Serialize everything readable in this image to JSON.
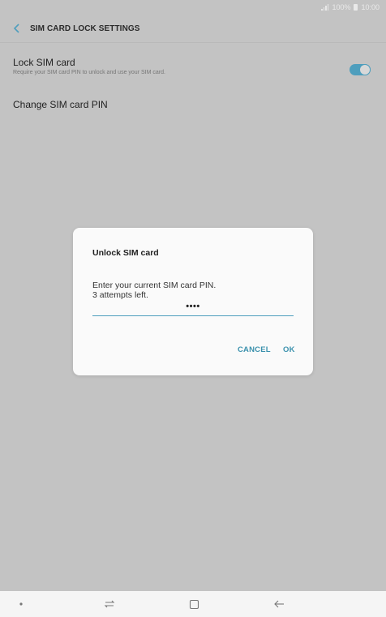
{
  "status_bar": {
    "battery": "100%",
    "time": "10:00"
  },
  "header": {
    "title": "SIM CARD LOCK SETTINGS"
  },
  "settings": {
    "lock_sim": {
      "title": "Lock SIM card",
      "subtitle": "Require your SIM card PIN to unlock and use your SIM card.",
      "enabled": true
    },
    "change_pin": {
      "title": "Change SIM card PIN"
    }
  },
  "dialog": {
    "title": "Unlock SIM card",
    "message_line1": "Enter your current SIM card PIN.",
    "message_line2": "3 attempts left.",
    "pin_value": "••••",
    "cancel_label": "CANCEL",
    "ok_label": "OK"
  },
  "colors": {
    "accent": "#4e9ebd",
    "overlay": "#c3c3c3"
  },
  "icons": [
    "signal-icon",
    "battery-icon",
    "back-icon",
    "nav-dot-icon",
    "recent-apps-icon",
    "home-icon",
    "nav-back-icon"
  ]
}
